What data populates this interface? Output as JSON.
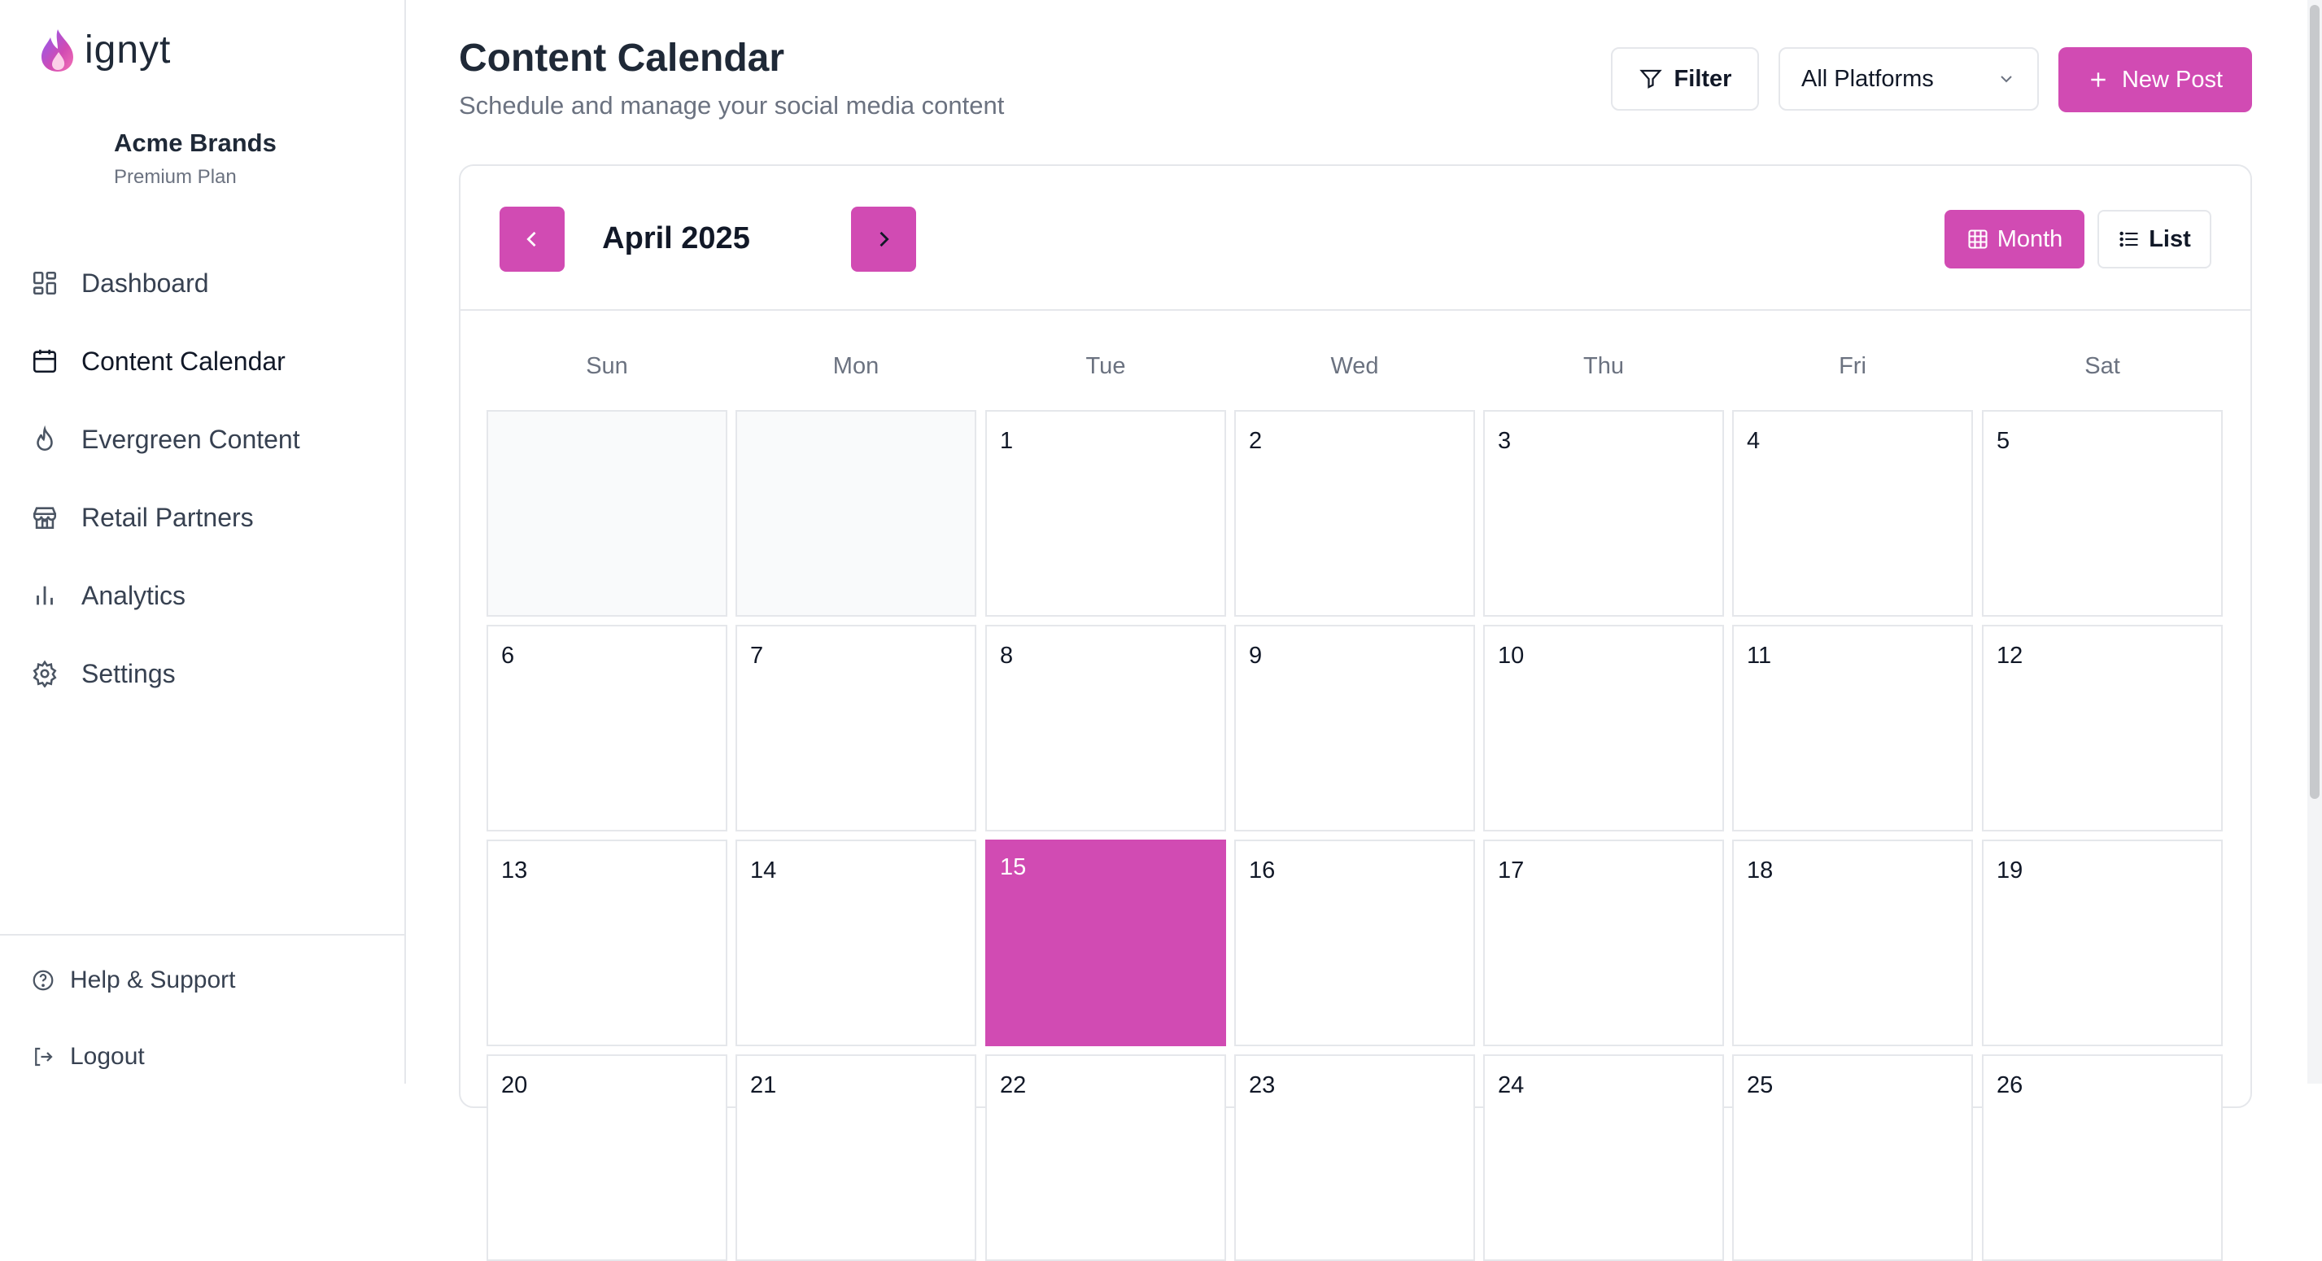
{
  "brand": {
    "name": "ignyt",
    "accent": "#d14bb3"
  },
  "account": {
    "name": "Acme Brands",
    "plan": "Premium Plan"
  },
  "nav": [
    {
      "label": "Dashboard",
      "icon": "dashboard-icon",
      "active": false
    },
    {
      "label": "Content Calendar",
      "icon": "calendar-icon",
      "active": true
    },
    {
      "label": "Evergreen Content",
      "icon": "flame-icon",
      "active": false
    },
    {
      "label": "Retail Partners",
      "icon": "store-icon",
      "active": false
    },
    {
      "label": "Analytics",
      "icon": "bar-chart-icon",
      "active": false
    },
    {
      "label": "Settings",
      "icon": "gear-icon",
      "active": false
    }
  ],
  "footer": {
    "help": "Help & Support",
    "logout": "Logout"
  },
  "header": {
    "title": "Content Calendar",
    "subtitle": "Schedule and manage your social media content",
    "filter": "Filter",
    "platform": "All Platforms",
    "new_post": "New Post"
  },
  "calendar": {
    "month": "April 2025",
    "view_month": "Month",
    "view_list": "List",
    "weekdays": [
      "Sun",
      "Mon",
      "Tue",
      "Wed",
      "Thu",
      "Fri",
      "Sat"
    ],
    "weeks": [
      [
        "",
        "",
        "1",
        "2",
        "3",
        "4",
        "5"
      ],
      [
        "6",
        "7",
        "8",
        "9",
        "10",
        "11",
        "12"
      ],
      [
        "13",
        "14",
        "15",
        "16",
        "17",
        "18",
        "19"
      ],
      [
        "20",
        "21",
        "22",
        "23",
        "24",
        "25",
        "26"
      ]
    ],
    "today": "15"
  }
}
